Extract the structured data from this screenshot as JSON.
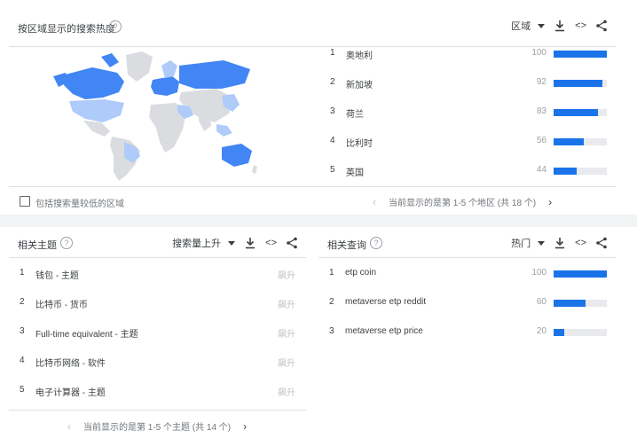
{
  "region": {
    "title": "按区域显示的搜索热度",
    "selector": "区域",
    "rows": [
      {
        "rank": "1",
        "name": "奥地利",
        "value": "100",
        "pct": 100
      },
      {
        "rank": "2",
        "name": "新加坡",
        "value": "92",
        "pct": 92
      },
      {
        "rank": "3",
        "name": "荷兰",
        "value": "83",
        "pct": 83
      },
      {
        "rank": "4",
        "name": "比利时",
        "value": "56",
        "pct": 56
      },
      {
        "rank": "5",
        "name": "英国",
        "value": "44",
        "pct": 44
      }
    ],
    "checkbox_label": "包括搜索量较低的区域",
    "pager": "当前显示的是第 1-5 个地区 (共 18 个)"
  },
  "topics": {
    "title": "相关主题",
    "selector": "搜索量上升",
    "badge": "飙升",
    "rows": [
      {
        "rank": "1",
        "name": "钱包 - 主题"
      },
      {
        "rank": "2",
        "name": "比特币 - 货币"
      },
      {
        "rank": "3",
        "name": "Full-time equivalent - 主题"
      },
      {
        "rank": "4",
        "name": "比特币网络 - 软件"
      },
      {
        "rank": "5",
        "name": "电子计算器 - 主题"
      }
    ],
    "pager": "当前显示的是第 1-5 个主题 (共 14 个)"
  },
  "queries": {
    "title": "相关查询",
    "selector": "热门",
    "rows": [
      {
        "rank": "1",
        "name": "etp coin",
        "value": "100",
        "pct": 100
      },
      {
        "rank": "2",
        "name": "metaverse etp reddit",
        "value": "60",
        "pct": 60
      },
      {
        "rank": "3",
        "name": "metaverse etp price",
        "value": "20",
        "pct": 20
      }
    ]
  },
  "icons": {
    "help": "?",
    "download": "download-icon",
    "embed": "<>",
    "share": "share-icon",
    "prev": "‹",
    "next": "›"
  },
  "colors": {
    "accent": "#1a73e8",
    "map_high": "#4285f4",
    "map_low": "#aecbfa",
    "map_none": "#dadce0"
  }
}
